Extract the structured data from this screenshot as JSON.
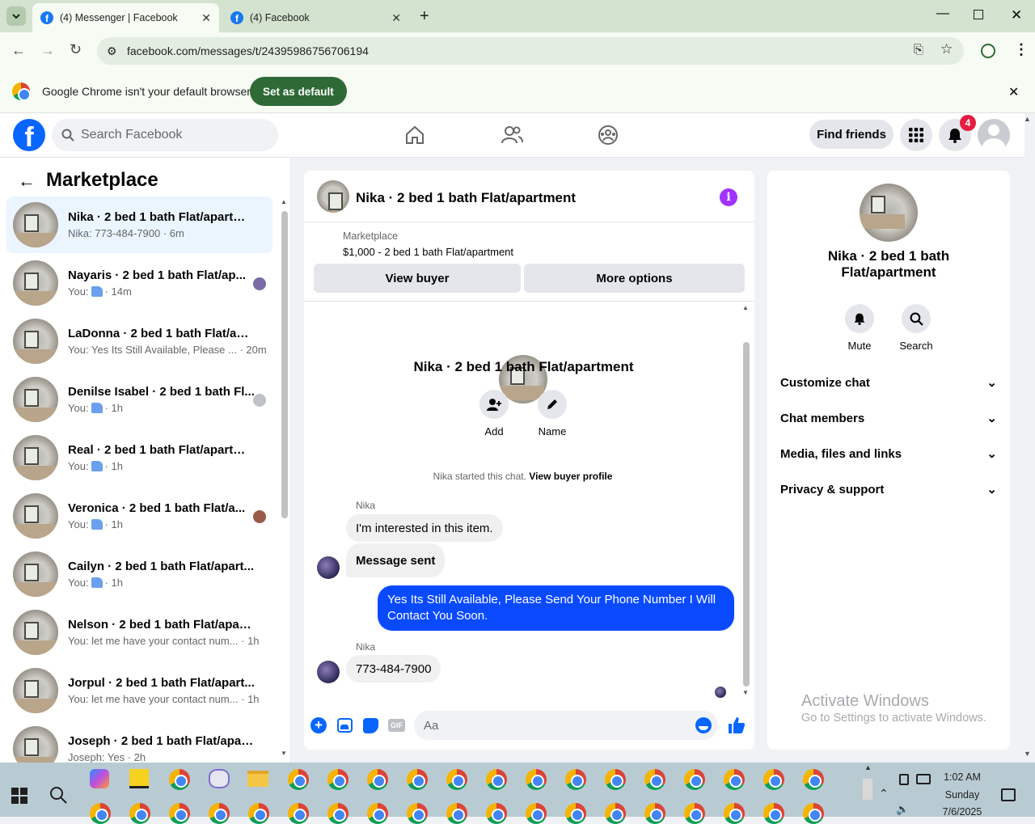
{
  "browser": {
    "tabs": [
      {
        "title": "(4) Messenger | Facebook",
        "active": true
      },
      {
        "title": "(4) Facebook",
        "active": false
      }
    ],
    "url": "facebook.com/messages/t/24395986756706194",
    "infobar_text": "Google Chrome isn't your default browser",
    "set_default_label": "Set as default"
  },
  "fbnav": {
    "search_placeholder": "Search Facebook",
    "find_friends": "Find friends",
    "notifications_count": "4"
  },
  "sidebar": {
    "title": "Marketplace",
    "conversations": [
      {
        "name": "Nika · 2 bed 1 bath Flat/apartment",
        "preview": "Nika: 773-484-7900 · 6m",
        "like": false,
        "selected": true
      },
      {
        "name": "Nayaris · 2 bed 1 bath Flat/ap...",
        "preview_prefix": "You:",
        "preview": "· 14m",
        "like": true
      },
      {
        "name": "LaDonna · 2 bed 1 bath Flat/apa...",
        "preview": "You: Yes Its Still Available, Please ... · 20m",
        "like": false
      },
      {
        "name": "Denilse Isabel · 2 bed 1 bath Fl...",
        "preview_prefix": "You:",
        "preview": "· 1h",
        "like": true
      },
      {
        "name": "Real · 2 bed 1 bath Flat/apartment",
        "preview_prefix": "You:",
        "preview": "· 1h",
        "like": true
      },
      {
        "name": "Veronica · 2 bed 1 bath Flat/a...",
        "preview_prefix": "You:",
        "preview": "· 1h",
        "like": true
      },
      {
        "name": "Cailyn · 2 bed 1 bath Flat/apart...",
        "preview_prefix": "You:",
        "preview": "· 1h",
        "like": true
      },
      {
        "name": "Nelson · 2 bed 1 bath Flat/apart...",
        "preview": "You: let me have your contact num... · 1h",
        "like": false
      },
      {
        "name": "Jorpul · 2 bed 1 bath Flat/apart...",
        "preview": "You: let me have your contact num... · 1h",
        "like": false
      },
      {
        "name": "Joseph · 2 bed 1 bath Flat/apart...",
        "preview": "Joseph: Yes · 2h",
        "like": false
      }
    ]
  },
  "chat": {
    "header_title": "Nika · 2 bed 1 bath Flat/apartment",
    "listing_label": "Marketplace",
    "listing_price": "$1,000 - 2 bed 1 bath Flat/apartment",
    "view_buyer": "View buyer",
    "more_options": "More options",
    "profile_name": "Nika · 2 bed 1 bath Flat/apartment",
    "add_label": "Add",
    "name_label": "Name",
    "started_text": "Nika started this chat.",
    "view_buyer_profile": "View buyer profile",
    "sender1": "Nika",
    "msg1": "I'm interested in this item.",
    "msg2": "Message sent",
    "msg_out": "Yes Its Still Available, Please Send Your Phone Number I Will Contact You Soon.",
    "sender2": "Nika",
    "msg3": "773-484-7900",
    "input_placeholder": "Aa"
  },
  "details": {
    "name": "Nika · 2 bed 1 bath Flat/apartment",
    "mute": "Mute",
    "search": "Search",
    "sections": [
      "Customize chat",
      "Chat members",
      "Media, files and links",
      "Privacy & support"
    ]
  },
  "watermark": {
    "line1": "Activate Windows",
    "line2": "Go to Settings to activate Windows."
  },
  "taskbar": {
    "time": "1:02 AM",
    "day": "Sunday",
    "date": "7/6/2025"
  }
}
